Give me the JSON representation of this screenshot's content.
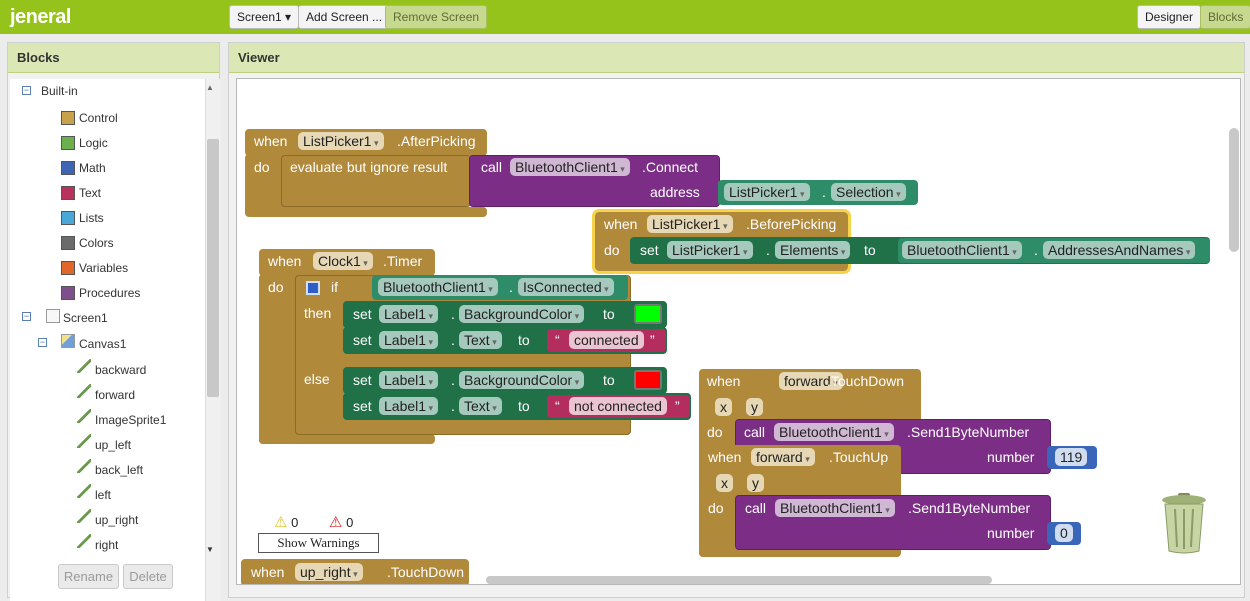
{
  "header": {
    "app_title": "jeneral",
    "screen_select": "Screen1 ▾",
    "add_screen": "Add Screen ...",
    "remove_screen": "Remove Screen",
    "designer": "Designer",
    "blocks": "Blocks"
  },
  "blocks_panel": {
    "title": "Blocks",
    "builtin": "Built-in",
    "builtin_items": [
      {
        "label": "Control",
        "color": "#c8a14b"
      },
      {
        "label": "Logic",
        "color": "#6ab04c"
      },
      {
        "label": "Math",
        "color": "#3f64b4"
      },
      {
        "label": "Text",
        "color": "#b8325e"
      },
      {
        "label": "Lists",
        "color": "#4aa8d8"
      },
      {
        "label": "Colors",
        "color": "#6b6b6b"
      },
      {
        "label": "Variables",
        "color": "#e0662e"
      },
      {
        "label": "Procedures",
        "color": "#7d4f8b"
      }
    ],
    "screen1": "Screen1",
    "canvas1": "Canvas1",
    "sprites": [
      "backward",
      "forward",
      "ImageSprite1",
      "up_left",
      "back_left",
      "left",
      "up_right",
      "right"
    ],
    "rename": "Rename",
    "delete": "Delete"
  },
  "viewer": {
    "title": "Viewer",
    "warnings_count": "0",
    "errors_count": "0",
    "show_warnings": "Show Warnings"
  },
  "code": {
    "when": "when",
    "do": "do",
    "set": "set",
    "to": "to",
    "call": "call",
    "if": "if",
    "then": "then",
    "else": "else",
    "dot": ".",
    "quote": "“",
    "quote_close": "”",
    "lp1": "ListPicker1",
    "after_picking": ".AfterPicking",
    "before_picking": ".BeforePicking",
    "evaluate": "evaluate but ignore result",
    "bt": "BluetoothClient1",
    "connect": ".Connect",
    "address": "address",
    "selection": "Selection",
    "elements": "Elements",
    "addresses": "AddressesAndNames",
    "clock": "Clock1",
    "timer": ".Timer",
    "isconnected": "IsConnected",
    "label1": "Label1",
    "bgcolor": "BackgroundColor",
    "text_prop": "Text",
    "connected": "connected",
    "not_connected": "not connected",
    "forward": "forward",
    "touchdown": ".TouchDown",
    "touchup": ".TouchUp",
    "x": "x",
    "y": "y",
    "send": ".Send1ByteNumber",
    "number": "number",
    "n119": "119",
    "n0": "0",
    "up_right": "up_right",
    "green": "#00ff00",
    "red": "#ff0000"
  }
}
